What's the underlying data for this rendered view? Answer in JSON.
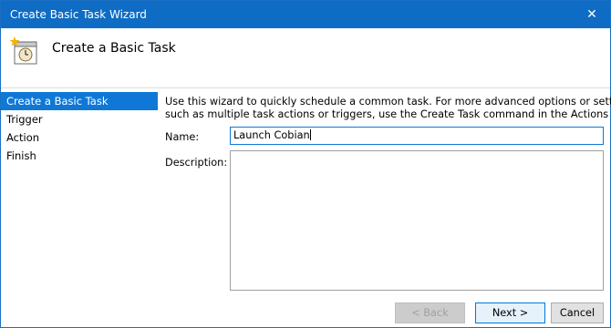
{
  "window": {
    "title": "Create Basic Task Wizard",
    "close_glyph": "✕"
  },
  "header": {
    "heading": "Create a Basic Task",
    "icon": "task-scheduler-icon"
  },
  "sidebar": {
    "steps": [
      {
        "label": "Create a Basic Task",
        "active": true
      },
      {
        "label": "Trigger",
        "active": false
      },
      {
        "label": "Action",
        "active": false
      },
      {
        "label": "Finish",
        "active": false
      }
    ]
  },
  "main": {
    "intro_line1": "Use this wizard to quickly schedule a common task.  For more advanced options or settings",
    "intro_line2": "such as multiple task actions or triggers, use the Create Task command in the Actions pane.",
    "name_label": "Name:",
    "name_value": "Launch Cobian",
    "description_label": "Description:",
    "description_value": ""
  },
  "buttons": {
    "back": "< Back",
    "next": "Next >",
    "cancel": "Cancel"
  },
  "colors": {
    "titlebar": "#0e6cc4",
    "accent": "#0f78d7"
  }
}
